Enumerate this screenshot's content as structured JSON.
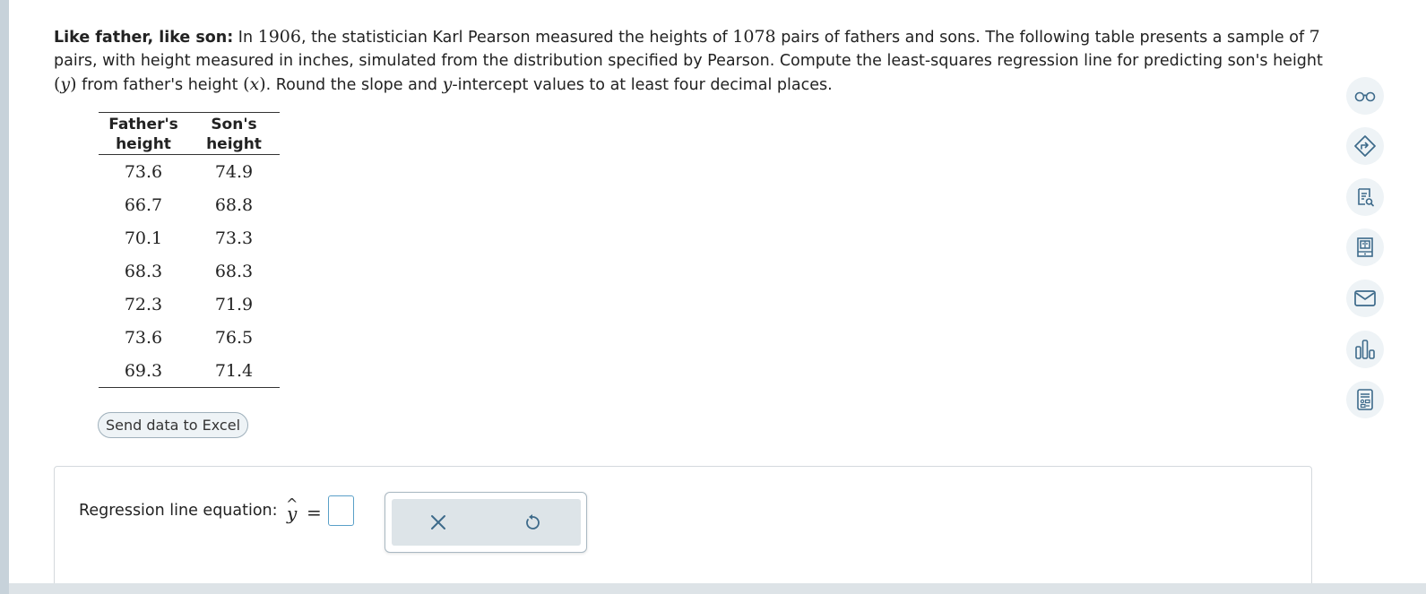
{
  "problem": {
    "heading": "Like father, like son:",
    "t1": " In ",
    "year": "1906",
    "t2": ", the statistician Karl Pearson measured the heights of ",
    "pairs_total": "1078",
    "t3": " pairs of fathers and sons. The following table presents a sample of ",
    "sample_n": "7",
    "t4": " pairs, with height measured in inches, simulated from the distribution specified by Pearson. Compute the least-squares regression line for predicting son's height ",
    "y_var": "y",
    "t5": " from father's height ",
    "x_var": "x",
    "t6": ". Round the slope and ",
    "y_var2": "y",
    "t7": "-intercept values to at least four decimal places."
  },
  "table": {
    "headers": [
      {
        "line1": "Father's",
        "line2": "height"
      },
      {
        "line1": "Son's",
        "line2": "height"
      }
    ],
    "rows": [
      [
        "73.6",
        "74.9"
      ],
      [
        "66.7",
        "68.8"
      ],
      [
        "70.1",
        "73.3"
      ],
      [
        "68.3",
        "68.3"
      ],
      [
        "72.3",
        "71.9"
      ],
      [
        "73.6",
        "76.5"
      ],
      [
        "69.3",
        "71.4"
      ]
    ]
  },
  "excel_button": "Send data to Excel",
  "answer": {
    "label": "Regression line equation:",
    "y_symbol": "y",
    "hat": "^",
    "equals": "=",
    "input_value": ""
  },
  "tools": [
    "close-icon",
    "undo-icon"
  ],
  "side_toolbar": [
    "glasses-icon",
    "pointer-icon",
    "document-search-icon",
    "book-icon",
    "mail-icon",
    "chart-icon",
    "calculator-icon"
  ],
  "colors": {
    "accent": "#5aa0c8",
    "icon": "#3d6a8a",
    "icon_bg": "#eef3f6"
  }
}
